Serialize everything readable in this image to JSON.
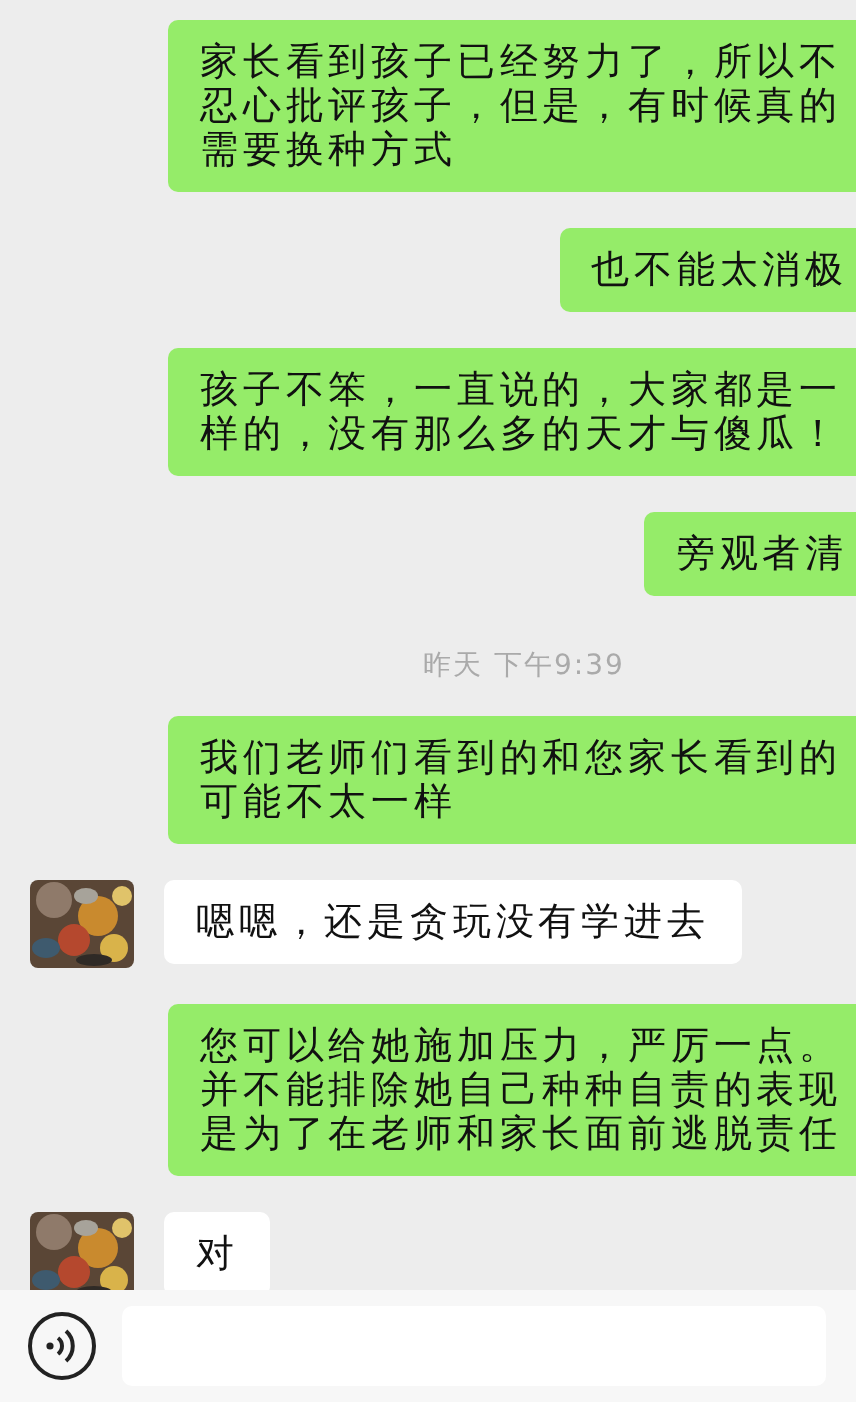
{
  "messages": [
    {
      "kind": "outgoing",
      "text": "家长看到孩子已经努力了，所以不忍心批评孩子，但是，有时候真的需要换种方式"
    },
    {
      "kind": "outgoing",
      "text": "也不能太消极"
    },
    {
      "kind": "outgoing",
      "text": "孩子不笨，一直说的，大家都是一样的，没有那么多的天才与傻瓜！"
    },
    {
      "kind": "outgoing",
      "text": "旁观者清"
    },
    {
      "kind": "time",
      "text": "昨天 下午9:39"
    },
    {
      "kind": "outgoing",
      "text": "我们老师们看到的和您家长看到的可能不太一样"
    },
    {
      "kind": "incoming",
      "text": "嗯嗯，还是贪玩没有学进去"
    },
    {
      "kind": "outgoing",
      "text": "您可以给她施加压力，严厉一点。并不能排除她自己种种自责的表现是为了在老师和家长面前逃脱责任"
    },
    {
      "kind": "incoming",
      "text": "对"
    }
  ]
}
